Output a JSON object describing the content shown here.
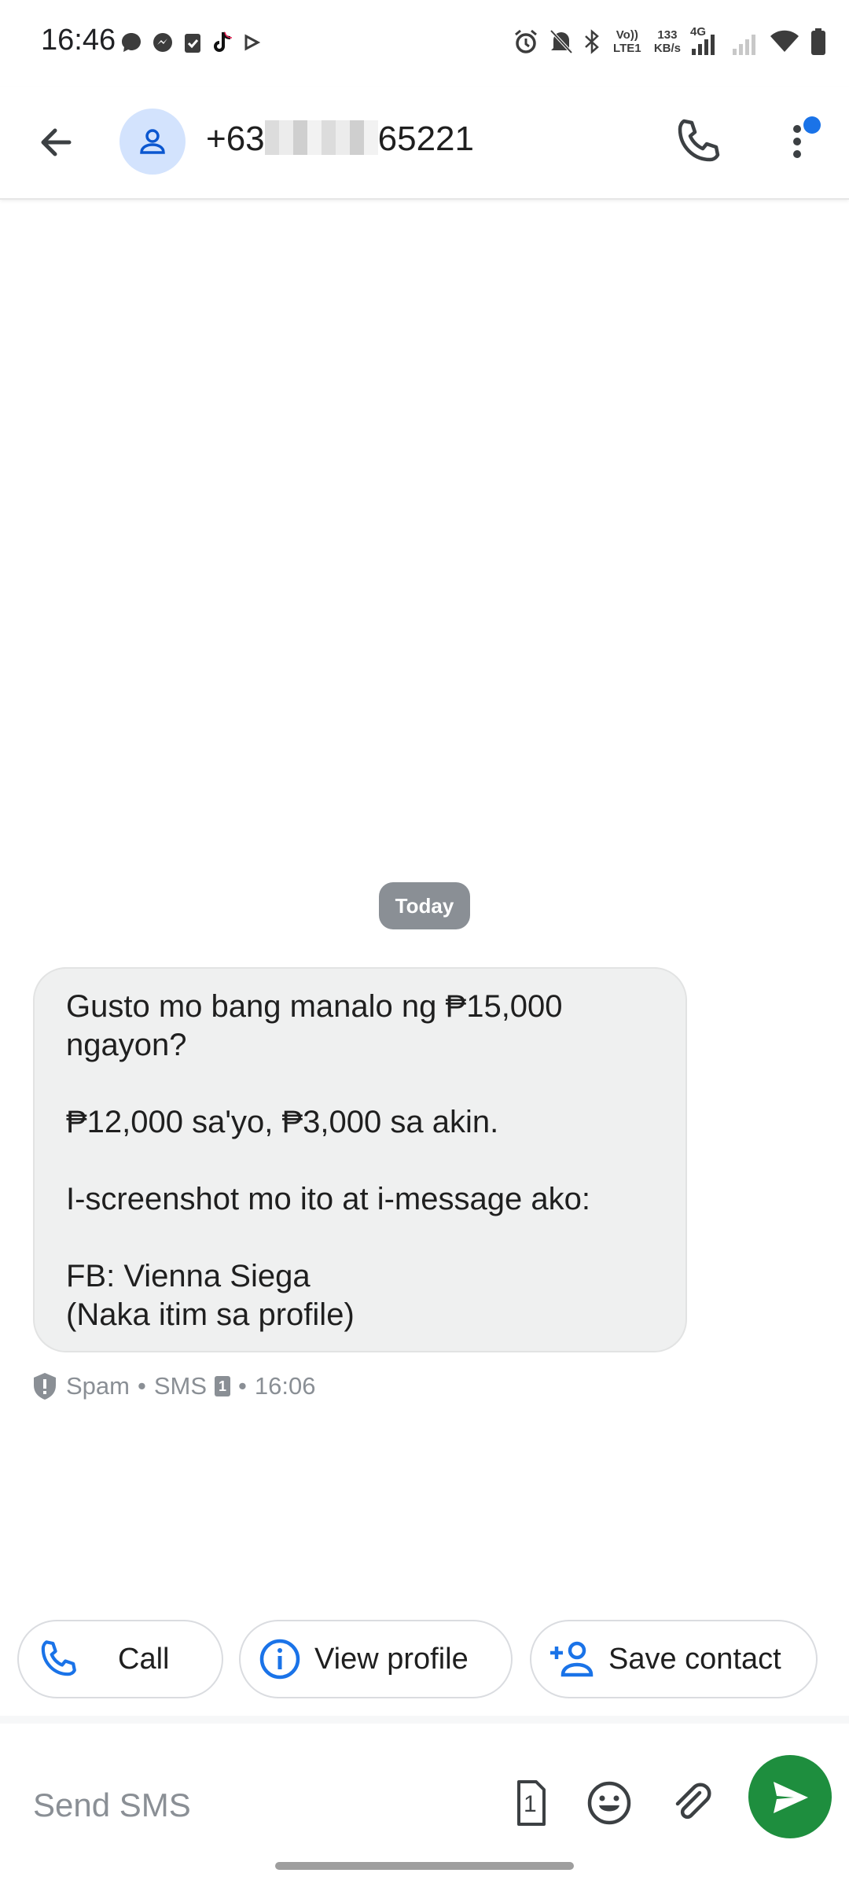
{
  "status_bar": {
    "time": "16:46",
    "volte_label": "Vo)) LTE1",
    "speed_value": "133",
    "speed_unit": "KB/s",
    "network": "4G",
    "left_icons": [
      "messenger-bubble-icon",
      "messenger-icon",
      "clipboard-icon",
      "tiktok-icon",
      "play-icon"
    ],
    "right_icons": [
      "alarm-icon",
      "mute-icon",
      "bluetooth-icon",
      "signal-icon",
      "wifi-icon",
      "battery-icon"
    ]
  },
  "header": {
    "number_prefix": "+63",
    "number_suffix": "65221",
    "icons": [
      "back-arrow-icon",
      "person-icon",
      "phone-icon",
      "more-vert-icon"
    ]
  },
  "conversation": {
    "date_label": "Today",
    "message_lines": [
      "Gusto mo bang manalo ng ₱15,000",
      "ngayon?",
      "",
      "₱12,000 sa'yo, ₱3,000 sa akin.",
      "",
      "I-screenshot mo ito at i-message ako:",
      "",
      "FB: Vienna Siega",
      "(Naka itim sa profile)"
    ],
    "meta": {
      "spam_label": "Spam",
      "channel": "SMS",
      "sim_number": "1",
      "time": "16:06"
    }
  },
  "suggestions": {
    "call_label": "Call",
    "view_profile_label": "View profile",
    "save_contact_label": "Save contact"
  },
  "compose": {
    "placeholder": "Send SMS",
    "sim_badge": "1"
  },
  "colors": {
    "accent_blue": "#1a73e8",
    "send_green": "#1e8e3e",
    "bubble_bg": "#eff0f0",
    "chip_gray": "#8a8f95"
  }
}
